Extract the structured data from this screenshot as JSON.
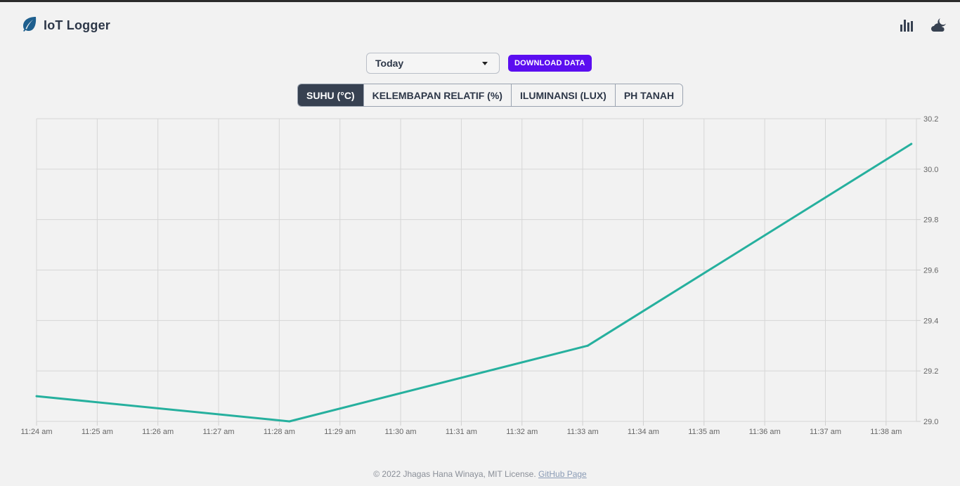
{
  "app": {
    "title": "IoT Logger",
    "logo_icon": "leaf-icon",
    "accent_color": "#5b0ef0",
    "line_color": "#26b09e"
  },
  "header": {
    "icons": [
      "bar-chart-icon",
      "cloud-moon-icon"
    ]
  },
  "controls": {
    "range_value": "Today",
    "download_label": "DOWNLOAD DATA"
  },
  "tabs": [
    {
      "label": "SUHU (°C)",
      "active": true
    },
    {
      "label": "KELEMBAPAN RELATIF (%)",
      "active": false
    },
    {
      "label": "ILUMINANSI (LUX)",
      "active": false
    },
    {
      "label": "PH TANAH",
      "active": false
    }
  ],
  "chart_data": {
    "type": "line",
    "title": "",
    "xlabel": "",
    "ylabel": "",
    "x_ticks": [
      "11:24 am",
      "11:25 am",
      "11:26 am",
      "11:27 am",
      "11:28 am",
      "11:29 am",
      "11:30 am",
      "11:31 am",
      "11:32 am",
      "11:33 am",
      "11:34 am",
      "11:35 am",
      "11:36 am",
      "11:37 am",
      "11:38 am"
    ],
    "y_ticks": [
      "29.0",
      "29.2",
      "29.4",
      "29.6",
      "29.8",
      "30.0",
      "30.2"
    ],
    "ylim": [
      29.0,
      30.2
    ],
    "y_axis_side": "right",
    "grid": true,
    "series": [
      {
        "x": [
          "11:24 am",
          "11:28:10 am",
          "11:33:05 am",
          "11:38:25 am"
        ],
        "y": [
          29.1,
          29.0,
          29.3,
          30.1
        ]
      }
    ]
  },
  "footer": {
    "text": "© 2022 Jhagas Hana Winaya, MIT License.",
    "link_label": "GitHub Page"
  }
}
